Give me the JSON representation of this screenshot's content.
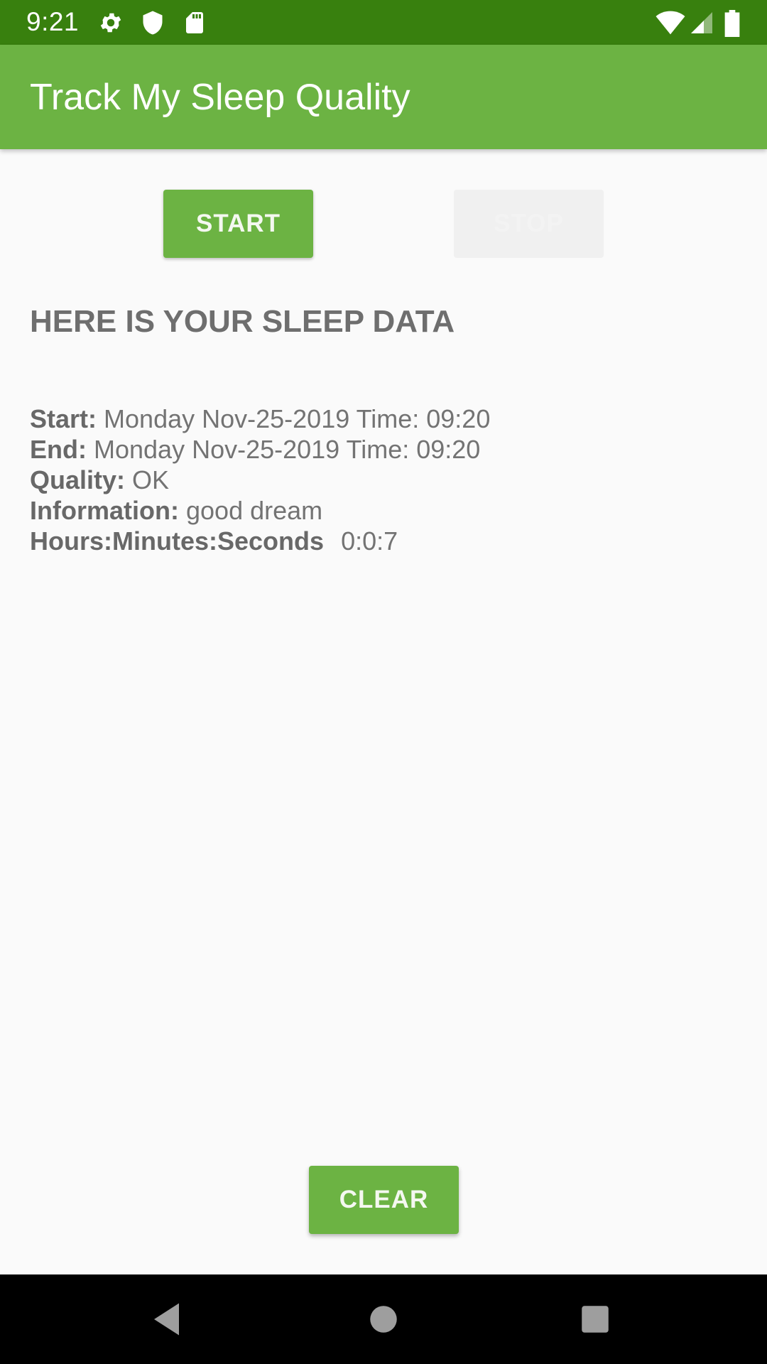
{
  "status_bar": {
    "time": "9:21",
    "icons": [
      "gear-icon",
      "shield-icon",
      "sd-card-icon",
      "wifi-icon",
      "cell-signal-icon",
      "battery-icon"
    ]
  },
  "app_bar": {
    "title": "Track My Sleep Quality"
  },
  "buttons": {
    "start_label": "START",
    "stop_label": "STOP",
    "clear_label": "CLEAR"
  },
  "main": {
    "heading": "HERE IS YOUR SLEEP DATA",
    "rows": [
      {
        "label": "Start:",
        "value": "Monday Nov-25-2019 Time: 09:20"
      },
      {
        "label": "End:",
        "value": "Monday Nov-25-2019 Time: 09:20"
      },
      {
        "label": "Quality:",
        "value": "OK"
      },
      {
        "label": "Information:",
        "value": "good dream"
      },
      {
        "label": "Hours:Minutes:Seconds",
        "value": "0:0:7"
      }
    ]
  },
  "nav_bar": {
    "icons": [
      "back-icon",
      "home-icon",
      "recents-icon"
    ]
  },
  "colors": {
    "status_bar": "#38800e",
    "primary": "#6cb343",
    "background": "#fafafa",
    "text": "#707070"
  }
}
